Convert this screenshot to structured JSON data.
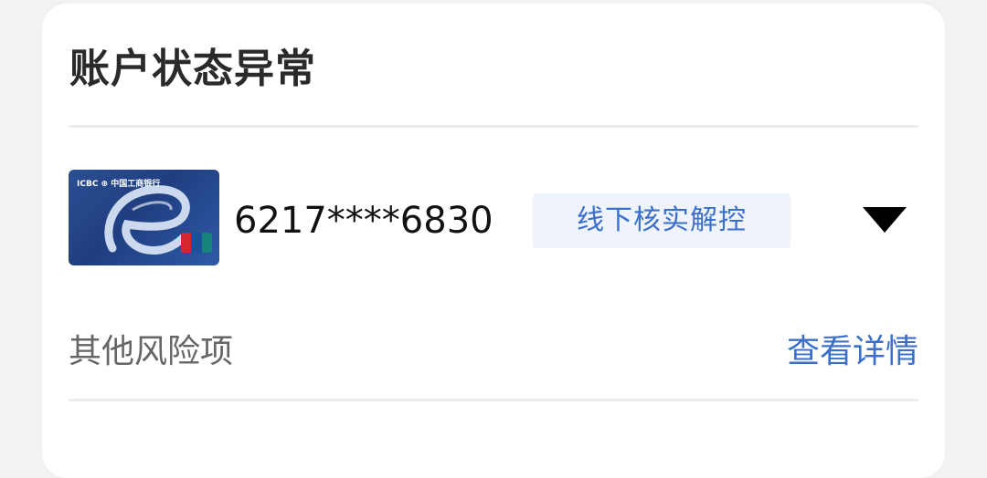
{
  "card_section": {
    "title": "账户状态异常"
  },
  "account": {
    "card_brand_text": "ICBC ⊕ 中国工商银行",
    "card_number": "6217****6830",
    "status_tag": "线下核实解控",
    "icons": {
      "card_image": "bank-card-image",
      "unionpay": "unionpay-logo",
      "dropdown": "triangle-down-icon"
    }
  },
  "risk": {
    "label": "其他风险项",
    "link_label": "查看详情"
  },
  "colors": {
    "accent": "#3b6fc9",
    "tag_background": "#eef3fc",
    "title_text": "#2a2a2a",
    "secondary_text": "#666666",
    "card_background": "#ffffff",
    "page_background": "#f2f2f4"
  }
}
